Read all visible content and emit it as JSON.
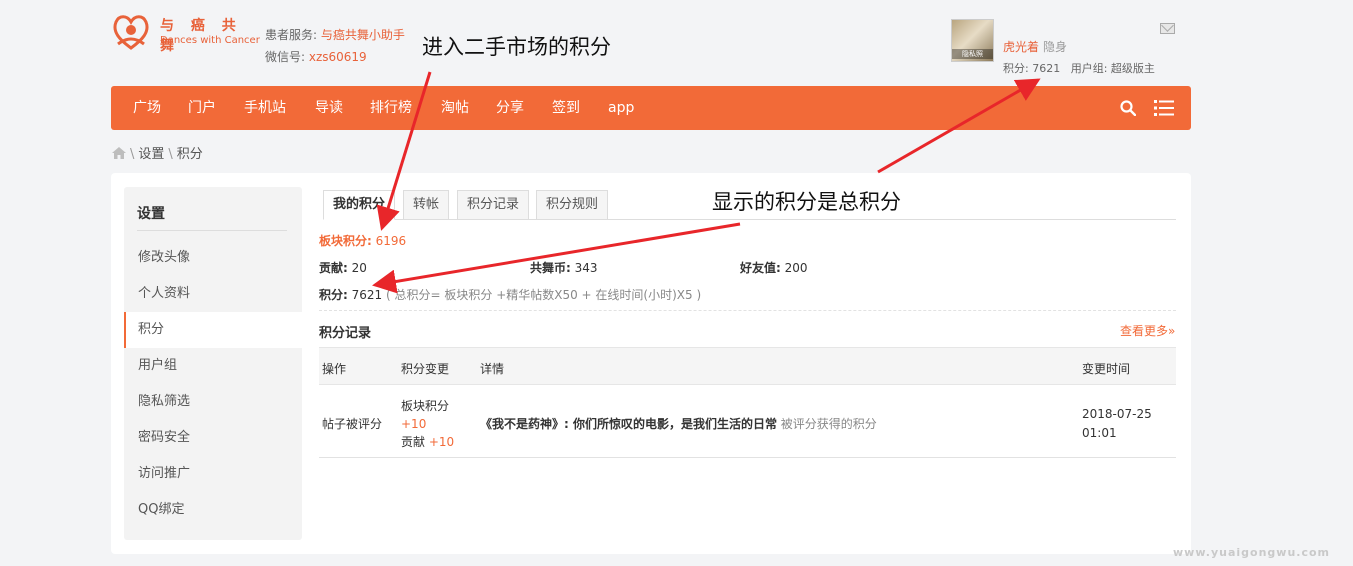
{
  "logo": {
    "cn": "与 癌 共 舞",
    "en": "Dances with Cancer"
  },
  "service": {
    "label1": "患者服务: ",
    "link1": "与癌共舞小助手",
    "label2": "微信号: ",
    "link2": "xzs60619"
  },
  "user": {
    "avatar_caption": "隐私照",
    "name": "虎光着",
    "status": "隐身",
    "points_label": "积分: ",
    "points": "7621",
    "group_label": "用户组: ",
    "group": "超级版主"
  },
  "nav": [
    "广场",
    "门户",
    "手机站",
    "导读",
    "排行榜",
    "淘帖",
    "分享",
    "签到",
    "app"
  ],
  "breadcrumb": [
    "设置",
    "积分"
  ],
  "sidebar": {
    "title": "设置",
    "items": [
      "修改头像",
      "个人资料",
      "积分",
      "用户组",
      "隐私筛选",
      "密码安全",
      "访问推广",
      "QQ绑定"
    ]
  },
  "tabs": [
    "我的积分",
    "转帐",
    "积分记录",
    "积分规则"
  ],
  "summary": {
    "board_label": "板块积分:",
    "board_value": "6196",
    "contrib_label": "贡献:",
    "contrib_value": "20",
    "coin_label": "共舞币:",
    "coin_value": "343",
    "friend_label": "好友值:",
    "friend_value": "200",
    "total_label": "积分:",
    "total_value": "7621",
    "formula": "( 总积分= 板块积分 +精华帖数X50 + 在线时间(小时)X5 )"
  },
  "records": {
    "title": "积分记录",
    "more": "查看更多»",
    "headers": [
      "操作",
      "积分变更",
      "详情",
      "变更时间"
    ],
    "row": {
      "action": "帖子被评分",
      "change1_label": "板块积分",
      "change1_value": "+10",
      "change2_label": "贡献",
      "change2_value": "+10",
      "detail_title": "《我不是药神》: 你们所惊叹的电影，是我们生活的日常",
      "detail_suffix": " 被评分获得的积分",
      "time_date": "2018-07-25",
      "time_clock": "01:01"
    }
  },
  "annotations": {
    "top": "进入二手市场的积分",
    "right": "显示的积分是总积分"
  },
  "watermark": "www.yuaigongwu.com",
  "colors": {
    "accent": "#f26a38",
    "annotation_arrow": "#e8262a"
  }
}
